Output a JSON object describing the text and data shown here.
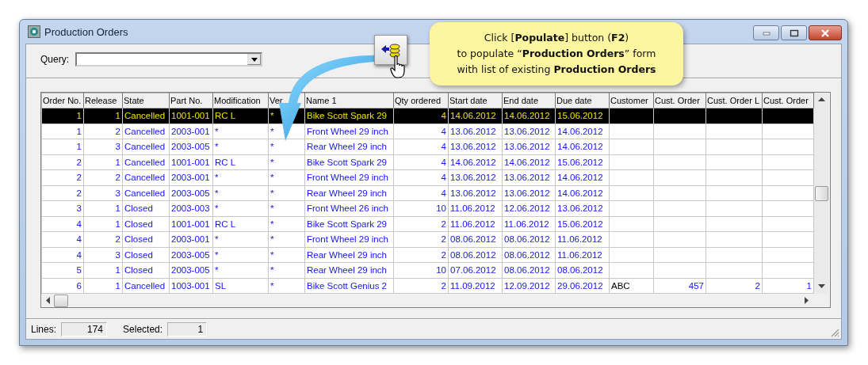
{
  "window": {
    "title": "Production Orders"
  },
  "query": {
    "label": "Query:"
  },
  "callout": {
    "lines": [
      "Click [**Populate**] button (**F2**)",
      "to populate “**Production Orders**” form",
      "with list of existing **Production Orders**"
    ]
  },
  "table": {
    "columns": [
      "Order No.",
      "Release",
      "State",
      "Part No.",
      "Modification",
      "Ver",
      "Name 1",
      "Qty ordered",
      "Start date",
      "End date",
      "Due date",
      "Customer",
      "Cust. Order",
      "Cust. Order L",
      "Cust. Order"
    ],
    "rows": [
      {
        "selected": true,
        "cells": [
          "1",
          "1",
          "Cancelled",
          "1001-001",
          "RC L",
          "*",
          "Bike Scott Spark 29",
          "4",
          "14.06.2012",
          "14.06.2012",
          "15.06.2012",
          "",
          "",
          "",
          ""
        ]
      },
      {
        "selected": false,
        "cells": [
          "1",
          "2",
          "Cancelled",
          "2003-001",
          "*",
          "*",
          "Front Wheel 29 inch",
          "4",
          "13.06.2012",
          "13.06.2012",
          "14.06.2012",
          "",
          "",
          "",
          ""
        ]
      },
      {
        "selected": false,
        "cells": [
          "1",
          "3",
          "Cancelled",
          "2003-005",
          "*",
          "*",
          "Rear Wheel 29 inch",
          "4",
          "13.06.2012",
          "13.06.2012",
          "14.06.2012",
          "",
          "",
          "",
          ""
        ]
      },
      {
        "selected": false,
        "cells": [
          "2",
          "1",
          "Cancelled",
          "1001-001",
          "RC L",
          "*",
          "Bike Scott Spark 29",
          "4",
          "14.06.2012",
          "14.06.2012",
          "15.06.2012",
          "",
          "",
          "",
          ""
        ]
      },
      {
        "selected": false,
        "cells": [
          "2",
          "2",
          "Cancelled",
          "2003-001",
          "*",
          "*",
          "Front Wheel 29 inch",
          "4",
          "13.06.2012",
          "13.06.2012",
          "14.06.2012",
          "",
          "",
          "",
          ""
        ]
      },
      {
        "selected": false,
        "cells": [
          "2",
          "3",
          "Cancelled",
          "2003-005",
          "*",
          "*",
          "Rear Wheel 29 inch",
          "4",
          "13.06.2012",
          "13.06.2012",
          "14.06.2012",
          "",
          "",
          "",
          ""
        ]
      },
      {
        "selected": false,
        "cells": [
          "3",
          "1",
          "Closed",
          "2003-003",
          "*",
          "*",
          "Front Wheel 26 inch",
          "10",
          "11.06.2012",
          "12.06.2012",
          "13.06.2012",
          "",
          "",
          "",
          ""
        ]
      },
      {
        "selected": false,
        "cells": [
          "4",
          "1",
          "Closed",
          "1001-001",
          "RC L",
          "*",
          "Bike Scott Spark 29",
          "2",
          "11.06.2012",
          "11.06.2012",
          "15.06.2012",
          "",
          "",
          "",
          ""
        ]
      },
      {
        "selected": false,
        "cells": [
          "4",
          "2",
          "Closed",
          "2003-001",
          "*",
          "*",
          "Front Wheel 29 inch",
          "2",
          "08.06.2012",
          "08.06.2012",
          "11.06.2012",
          "",
          "",
          "",
          ""
        ]
      },
      {
        "selected": false,
        "cells": [
          "4",
          "3",
          "Closed",
          "2003-005",
          "*",
          "*",
          "Rear Wheel 29 inch",
          "2",
          "08.06.2012",
          "08.06.2012",
          "11.06.2012",
          "",
          "",
          "",
          ""
        ]
      },
      {
        "selected": false,
        "cells": [
          "5",
          "1",
          "Closed",
          "2003-005",
          "*",
          "*",
          "Rear Wheel 29 inch",
          "10",
          "07.06.2012",
          "08.06.2012",
          "08.06.2012",
          "",
          "",
          "",
          ""
        ]
      },
      {
        "selected": false,
        "cells": [
          "6",
          "1",
          "Cancelled",
          "1003-001",
          "SL",
          "*",
          "Bike Scott Genius 2",
          "2",
          "11.09.2012",
          "12.09.2012",
          "29.06.2012",
          "ABC",
          "457",
          "2",
          "1"
        ]
      }
    ]
  },
  "status_bar": {
    "lines_label": "Lines:",
    "lines_value": "174",
    "selected_label": "Selected:",
    "selected_value": "1"
  }
}
